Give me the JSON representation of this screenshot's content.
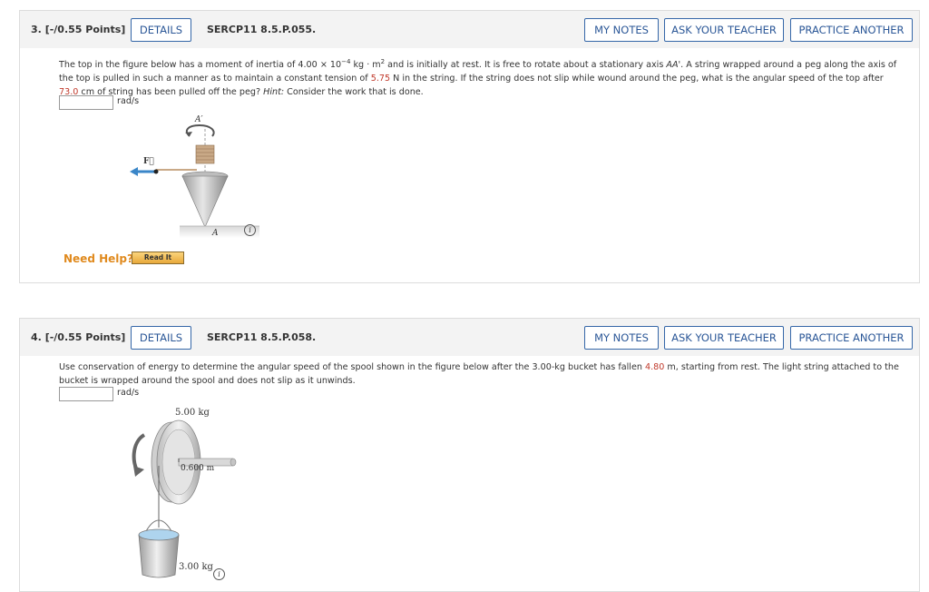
{
  "q3": {
    "number": "3.",
    "points": "[-/0.55 Points]",
    "details": "DETAILS",
    "code": "SERCP11 8.5.P.055.",
    "my_notes": "MY NOTES",
    "ask_teacher": "ASK YOUR TEACHER",
    "practice": "PRACTICE ANOTHER",
    "text_1": "The top in the figure below has a moment of inertia of 4.00 × 10",
    "text_exp": "−4",
    "text_2": " kg · m",
    "text_sq": "2",
    "text_3": " and is initially at rest. It is free to rotate about a stationary axis ",
    "text_axis": "AA'",
    "text_4": ". A string wrapped around a peg along the axis of the top is pulled in such a manner as to maintain a constant tension of ",
    "tension": "5.75",
    "text_5": " N in the string. If the string does not slip while wound around the peg, what is the angular speed of the top after ",
    "length": "73.0",
    "text_6": " cm of string has been pulled off the peg? ",
    "hint_label": "Hint:",
    "hint_text": " Consider the work that is done.",
    "unit": "rad/s",
    "input_value": "",
    "figure": {
      "label_a_top": "A′",
      "label_f": "F⃗",
      "label_a_bottom": "A"
    },
    "need_help": "Need Help?",
    "read_it": "Read It",
    "info_icon": "i"
  },
  "q4": {
    "number": "4.",
    "points": "[-/0.55 Points]",
    "details": "DETAILS",
    "code": "SERCP11 8.5.P.058.",
    "my_notes": "MY NOTES",
    "ask_teacher": "ASK YOUR TEACHER",
    "practice": "PRACTICE ANOTHER",
    "text_1": "Use conservation of energy to determine the angular speed of the spool shown in the figure below after the 3.00-kg bucket has fallen ",
    "distance": "4.80",
    "text_2": " m, starting from rest. The light string attached to the bucket is wrapped around the spool and does not slip as it unwinds.",
    "unit": "rad/s",
    "input_value": "",
    "figure": {
      "spool_mass": "5.00 kg",
      "radius": "0.600 m",
      "bucket_mass": "3.00 kg"
    },
    "info_icon": "i"
  },
  "colors": {
    "accent": "#2b5797",
    "highlight": "#c0392b",
    "need_help": "#e08a1e"
  }
}
